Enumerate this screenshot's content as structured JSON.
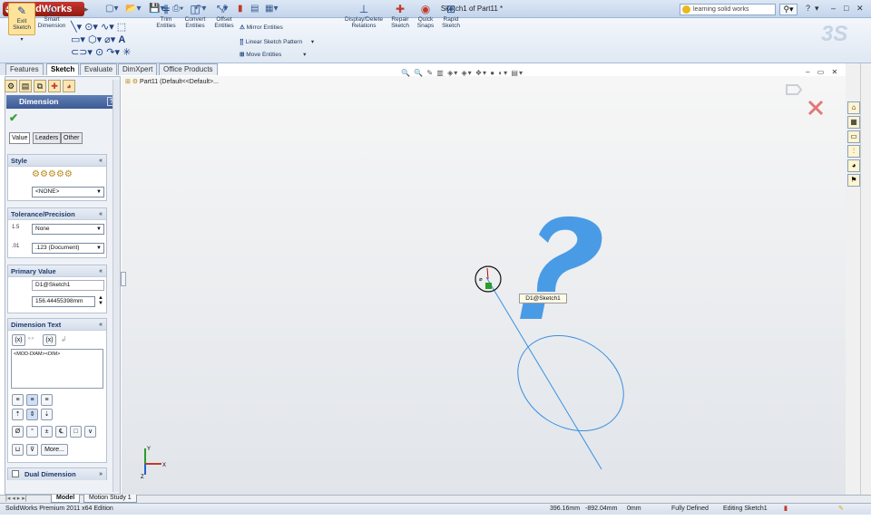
{
  "app": {
    "name": "SolidWorks",
    "window_title": "Sketch1 of Part11 *",
    "search_placeholder": "learning solid works",
    "help_label": "?",
    "window_controls": [
      "–",
      "□",
      "✕"
    ]
  },
  "ribbon": {
    "buttons": [
      {
        "label": "Exit Sketch",
        "icon": "exit-sketch-icon"
      },
      {
        "label": "Smart Dimension",
        "icon": "smart-dimension-icon"
      },
      {
        "label": "Trim Entities",
        "icon": "trim-icon"
      },
      {
        "label": "Convert Entities",
        "icon": "convert-icon"
      },
      {
        "label": "Offset Entities",
        "icon": "offset-icon"
      },
      {
        "label": "Display/Delete Relations",
        "icon": "relations-icon"
      },
      {
        "label": "Repair Sketch",
        "icon": "repair-icon"
      },
      {
        "label": "Quick Snaps",
        "icon": "snaps-icon"
      },
      {
        "label": "Rapid Sketch",
        "icon": "rapid-sketch-icon"
      }
    ],
    "text_items": [
      "Mirror Entities",
      "Linear Sketch Pattern",
      "Move Entities"
    ]
  },
  "command_tabs": [
    "Features",
    "Sketch",
    "Evaluate",
    "DimXpert",
    "Office Products"
  ],
  "active_command_tab": "Sketch",
  "property_manager": {
    "title": "Dimension",
    "tabs": [
      "Value",
      "Leaders",
      "Other"
    ],
    "style": {
      "header": "Style",
      "selected": "<NONE>"
    },
    "tolerance": {
      "header": "Tolerance/Precision",
      "tolerance_type": "None",
      "precision": ".123 (Document)"
    },
    "primary_value": {
      "header": "Primary Value",
      "name": "D1@Sketch1",
      "value": "156.44455398mm"
    },
    "dimension_text": {
      "header": "Dimension Text",
      "text": "<MOD-DIAM><DIM>",
      "more_label": "More..."
    },
    "dual_dimension": {
      "label": "Dual Dimension"
    }
  },
  "graphics": {
    "feature_tree_root": "Part11  (Default<<Default>...",
    "dimension_tag": "D1@Sketch1"
  },
  "bottom_tabs": [
    "Model",
    "Motion Study 1"
  ],
  "status_bar": {
    "edition": "SolidWorks Premium 2011 x64 Edition",
    "x": "396.16mm",
    "y": "-892.04mm",
    "z": "0mm",
    "state": "Fully Defined",
    "mode": "Editing Sketch1"
  },
  "colors": {
    "question_mark": "#4a9be6",
    "sketch_line": "#3a8fe0",
    "accent_red": "#c8372d"
  }
}
